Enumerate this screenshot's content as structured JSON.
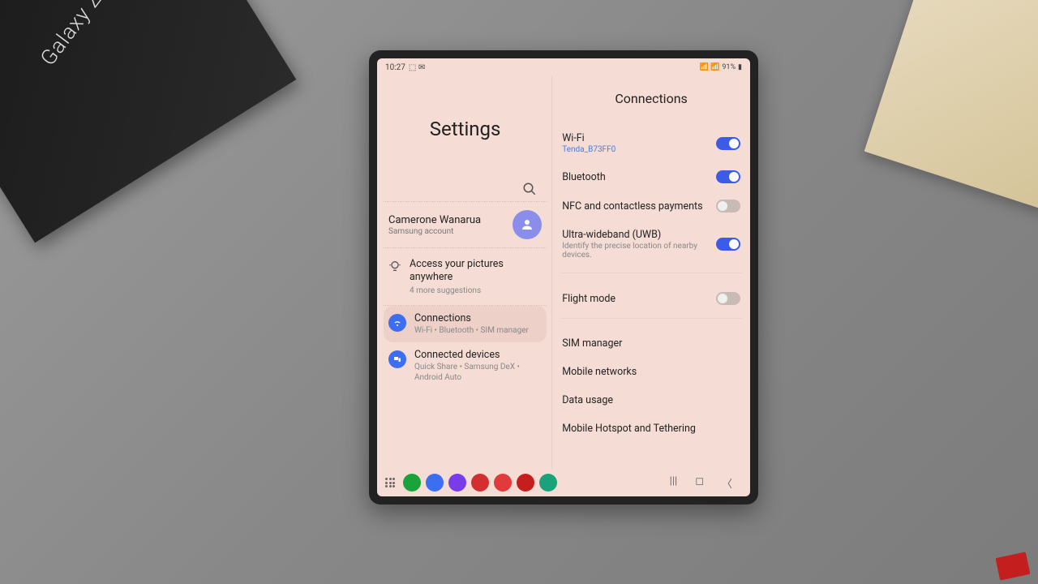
{
  "status": {
    "time": "10:27",
    "battery": "91%"
  },
  "left": {
    "title": "Settings",
    "account": {
      "name": "Camerone Wanarua",
      "sub": "Samsung account"
    },
    "suggestion": {
      "title": "Access your pictures anywhere",
      "sub": "4 more suggestions"
    },
    "items": [
      {
        "title": "Connections",
        "sub": "Wi-Fi • Bluetooth • SIM manager",
        "selected": true
      },
      {
        "title": "Connected devices",
        "sub": "Quick Share • Samsung DeX • Android Auto",
        "selected": false
      }
    ]
  },
  "right": {
    "title": "Connections",
    "toggles": [
      {
        "title": "Wi-Fi",
        "sub": "Tenda_B73FF0",
        "subColor": "blue",
        "on": true
      },
      {
        "title": "Bluetooth",
        "sub": "",
        "on": true
      },
      {
        "title": "NFC and contactless payments",
        "sub": "",
        "on": false
      },
      {
        "title": "Ultra-wideband (UWB)",
        "sub": "Identify the precise location of nearby devices.",
        "subColor": "gray",
        "on": true
      }
    ],
    "flight": {
      "title": "Flight mode",
      "on": false
    },
    "links": [
      "SIM manager",
      "Mobile networks",
      "Data usage",
      "Mobile Hotspot and Tethering"
    ]
  },
  "dock_colors": [
    "#1aa33a",
    "#3b6ef0",
    "#7a3be8",
    "#d32f2f",
    "#e03a3a",
    "#c41e1e",
    "#1aa37a"
  ]
}
